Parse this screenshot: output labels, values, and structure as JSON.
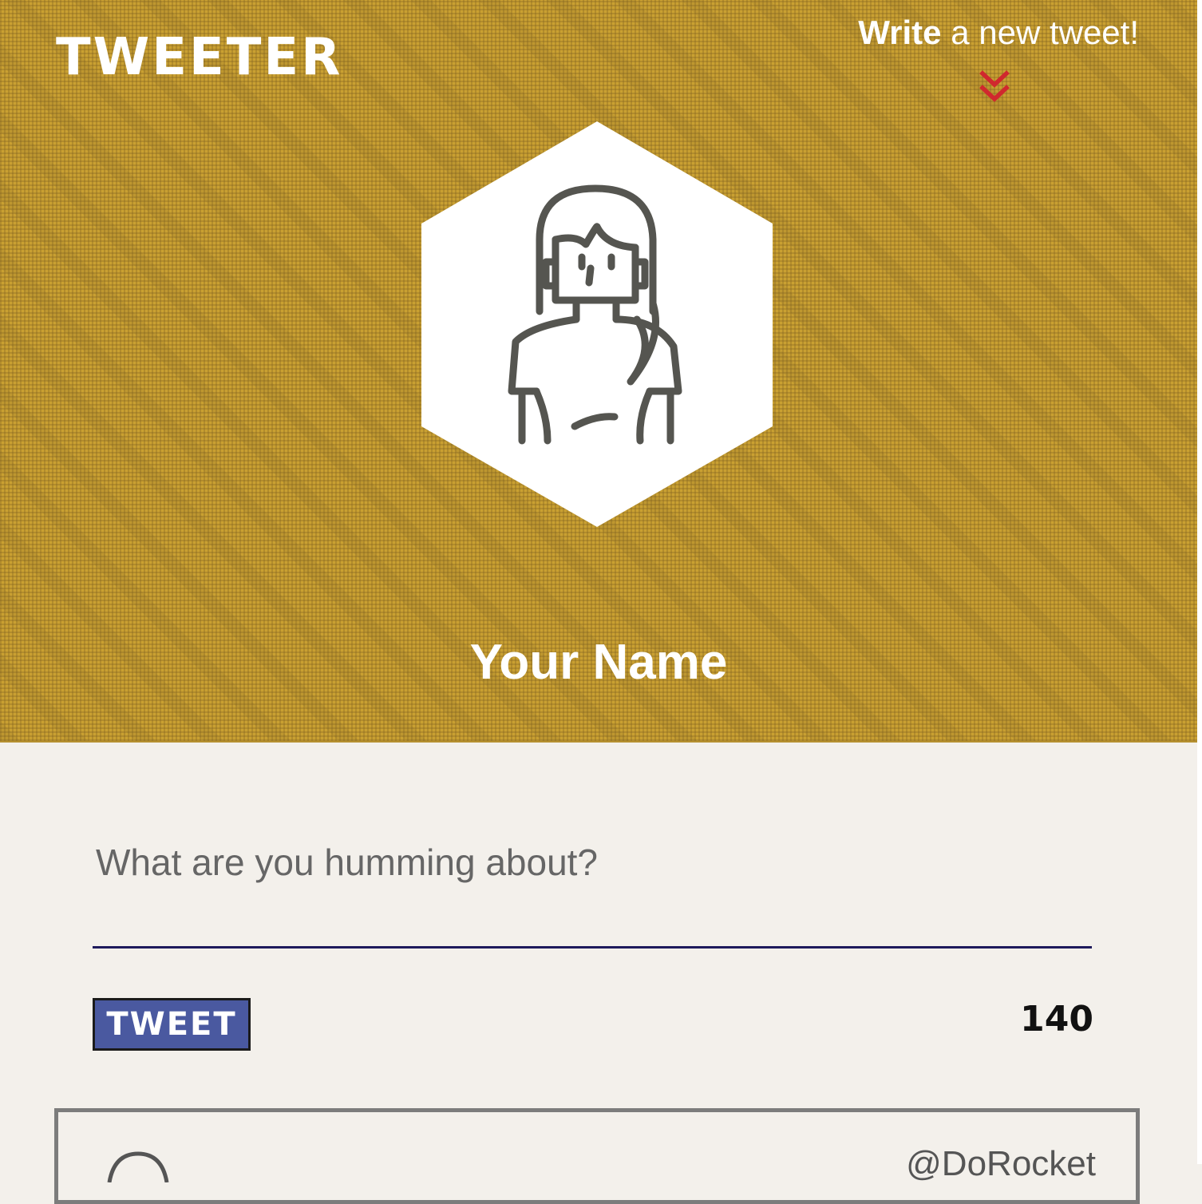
{
  "app": {
    "logo_text": "TWEETER"
  },
  "header": {
    "compose_bold": "Write",
    "compose_rest": " a new tweet!",
    "user_name": "Your Name",
    "icons": {
      "compose_toggle": "chevron-double-down-icon",
      "avatar": "woman-avatar-icon"
    }
  },
  "composer": {
    "placeholder": "What are you humming about?",
    "value": "",
    "submit_label": "TWEET",
    "char_counter": "140"
  },
  "feed": {
    "tweets": [
      {
        "handle": "@DoRocket"
      }
    ]
  },
  "colors": {
    "header_bg": "#c9a032",
    "page_bg": "#f3f0eb",
    "button_bg": "#4a59a0",
    "input_underline": "#1e1a5c",
    "chevron": "#d0282e",
    "card_border": "#7c7c7c"
  }
}
